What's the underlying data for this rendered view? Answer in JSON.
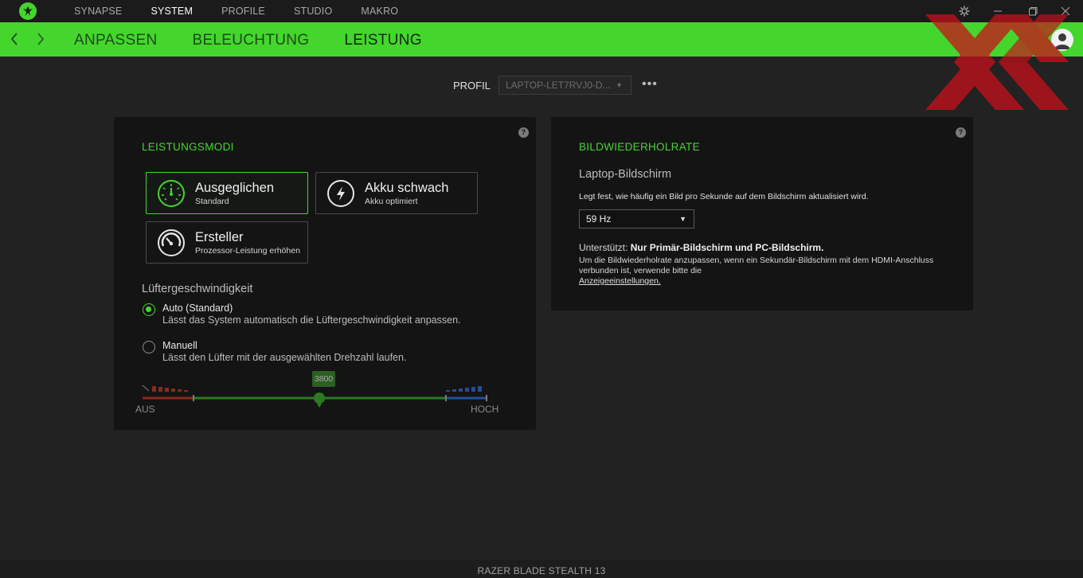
{
  "topbar": {
    "tabs": [
      {
        "label": "SYNAPSE",
        "active": false
      },
      {
        "label": "SYSTEM",
        "active": true
      },
      {
        "label": "PROFILE",
        "active": false
      },
      {
        "label": "STUDIO",
        "active": false
      },
      {
        "label": "MAKRO",
        "active": false
      }
    ],
    "icons": [
      "razer-logo-icon",
      "settings-gear-icon",
      "minimize-icon",
      "maximize-icon",
      "close-icon"
    ]
  },
  "subnav": {
    "tabs": [
      {
        "label": "ANPASSEN",
        "active": false
      },
      {
        "label": "BELEUCHTUNG",
        "active": false
      },
      {
        "label": "LEISTUNG",
        "active": true
      }
    ]
  },
  "profile": {
    "label": "PROFIL",
    "value": "LAPTOP-LET7RVJ0-D..."
  },
  "performance": {
    "title": "LEISTUNGSMODI",
    "modes": [
      {
        "title": "Ausgeglichen",
        "subtitle": "Standard",
        "active": true,
        "icon": "speedometer-icon"
      },
      {
        "title": "Akku schwach",
        "subtitle": "Akku optimiert",
        "active": false,
        "icon": "lightning-bolt-icon"
      },
      {
        "title": "Ersteller",
        "subtitle": "Prozessor-Leistung erhöhen",
        "active": false,
        "icon": "gauge-dial-icon"
      }
    ],
    "fan": {
      "title": "Lüftergeschwindigkeit",
      "options": [
        {
          "label": "Auto (Standard)",
          "description": "Lässt das System automatisch die Lüftergeschwindigkeit anpassen.",
          "checked": true
        },
        {
          "label": "Manuell",
          "description": "Lässt den Lüfter mit der ausgewählten Drehzahl laufen.",
          "checked": false
        }
      ],
      "slider": {
        "value": "3800",
        "min_label": "AUS",
        "max_label": "HOCH",
        "fraction": 0.51
      }
    }
  },
  "refresh": {
    "title": "BILDWIEDERHOLRATE",
    "subtitle": "Laptop-Bildschirm",
    "description": "Legt fest, wie häufig ein Bild pro Sekunde auf dem Bildschirm aktualisiert wird.",
    "selected": "59 Hz",
    "supported_prefix": "Unterstützt:",
    "supported_value": "Nur Primär-Bildschirm und PC-Bildschirm.",
    "note": "Um die Bildwiederholrate anzupassen, wenn ein Sekundär-Bildschirm mit dem HDMI-Anschluss verbunden ist, verwende bitte die",
    "link": "Anzeigeeinstellungen."
  },
  "footer": {
    "device": "RAZER BLADE STEALTH 13"
  },
  "colors": {
    "accent": "#44d62c",
    "background": "#222222",
    "panel": "#141414",
    "slider_low": "#8b2a1c",
    "slider_high": "#1f4f9a"
  }
}
